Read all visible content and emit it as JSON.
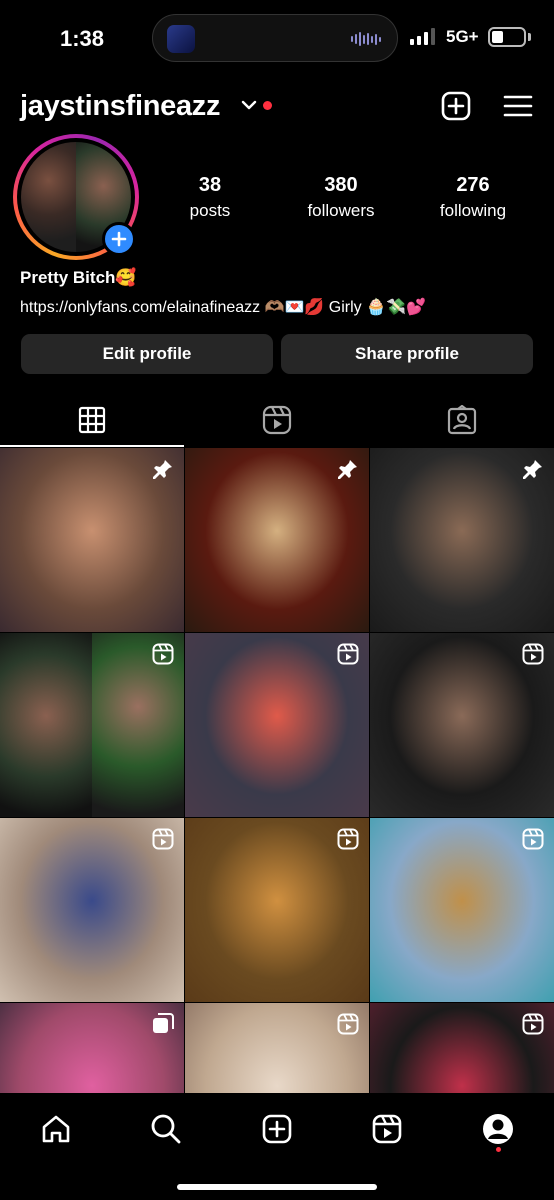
{
  "status_bar": {
    "time": "1:38",
    "network": "5G+",
    "signal_bars_active": 3,
    "battery_level": 0.35
  },
  "header": {
    "username": "jaystinsfineazz",
    "has_notification_dot": true
  },
  "profile": {
    "stats": [
      {
        "value": "38",
        "label": "posts"
      },
      {
        "value": "380",
        "label": "followers"
      },
      {
        "value": "276",
        "label": "following"
      }
    ],
    "bio_name": "Pretty Bitch🥰",
    "bio_link": "https://onlyfans.com/elainafineazz 🫶🏽💌💋 Girly 🧁💸💕"
  },
  "buttons": {
    "edit_profile": "Edit profile",
    "share_profile": "Share profile"
  },
  "tabs": [
    {
      "name": "grid",
      "icon": "grid-icon",
      "active": true
    },
    {
      "name": "reels",
      "icon": "reels-icon",
      "active": false
    },
    {
      "name": "tagged",
      "icon": "tagged-icon",
      "active": false
    }
  ],
  "grid": [
    {
      "type": "photo",
      "badge": "pin-icon",
      "colors": [
        "#6a4a3a",
        "#c89070",
        "#3a2a30"
      ]
    },
    {
      "type": "photo",
      "badge": "pin-icon",
      "colors": [
        "#5a1a10",
        "#d4b080",
        "#2a1a10"
      ]
    },
    {
      "type": "photo",
      "badge": "pin-icon",
      "colors": [
        "#2a2a2a",
        "#8a6a55",
        "#1a1a1a"
      ]
    },
    {
      "type": "split",
      "badge": "reel-icon",
      "colors": [
        "#2a3a2a",
        "#1a1a1a"
      ]
    },
    {
      "type": "reel",
      "badge": "reel-icon",
      "colors": [
        "#3a3a4a",
        "#e05a4a",
        "#4a3a4a"
      ]
    },
    {
      "type": "reel",
      "badge": "reel-icon",
      "colors": [
        "#1a1a1a",
        "#8a6a58",
        "#2a2a2a"
      ]
    },
    {
      "type": "reel",
      "badge": "reel-icon",
      "colors": [
        "#a08a7a",
        "#3a4a8a",
        "#d0c0b0"
      ]
    },
    {
      "type": "reel",
      "badge": "reel-icon",
      "colors": [
        "#6a4a20",
        "#d09040",
        "#5a3a18"
      ]
    },
    {
      "type": "reel",
      "badge": "reel-icon",
      "colors": [
        "#88a8c8",
        "#c0904a",
        "#40a0b0"
      ]
    },
    {
      "type": "photo",
      "badge": "carousel-icon",
      "colors": [
        "#a04a6a",
        "#e060a0",
        "#3a2a3a"
      ]
    },
    {
      "type": "reel",
      "badge": "reel-icon",
      "colors": [
        "#c0a890",
        "#e8d8c8",
        "#8a7060"
      ]
    },
    {
      "type": "reel",
      "badge": "reel-icon",
      "colors": [
        "#1a1a1a",
        "#c0304a",
        "#5a2030"
      ]
    }
  ],
  "bottom_nav": [
    {
      "name": "home",
      "icon": "home-icon"
    },
    {
      "name": "search",
      "icon": "search-icon"
    },
    {
      "name": "create",
      "icon": "plus-square-icon"
    },
    {
      "name": "reels",
      "icon": "reels-icon"
    },
    {
      "name": "profile",
      "icon": "profile-icon",
      "active": true
    }
  ]
}
